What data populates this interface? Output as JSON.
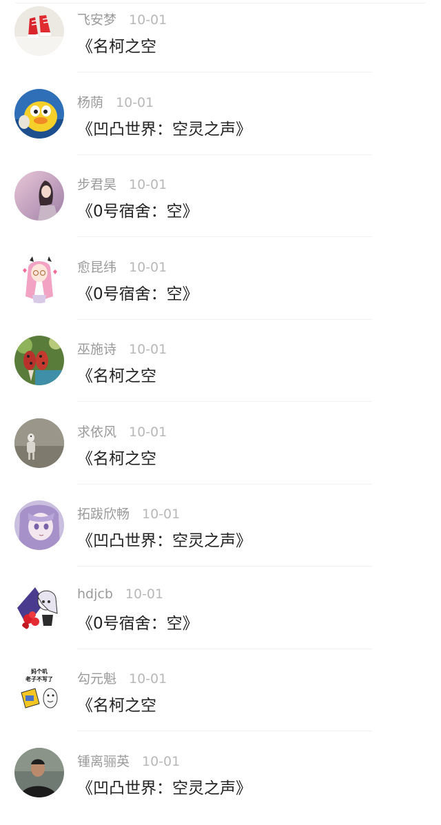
{
  "feed": {
    "items": [
      {
        "name": "飞安梦",
        "date": "10-01",
        "title": "《名柯之空",
        "avatar": "red-sneakers-avatar-icon"
      },
      {
        "name": "杨荫",
        "date": "10-01",
        "title": "《凹凸世界：空灵之声》",
        "avatar": "yellow-duck-avatar-icon"
      },
      {
        "name": "步君昊",
        "date": "10-01",
        "title": "《0号宿舍：空》",
        "avatar": "girl-portrait-avatar-icon"
      },
      {
        "name": "愈昆纬",
        "date": "10-01",
        "title": "《0号宿舍：空》",
        "avatar": "pink-hair-anime-avatar-icon"
      },
      {
        "name": "巫施诗",
        "date": "10-01",
        "title": "《名柯之空",
        "avatar": "ladybug-shoes-avatar-icon"
      },
      {
        "name": "求依风",
        "date": "10-01",
        "title": "《名柯之空",
        "avatar": "figure-photo-avatar-icon"
      },
      {
        "name": "拓跋欣畅",
        "date": "10-01",
        "title": "《凹凸世界：空灵之声》",
        "avatar": "purple-anime-girl-avatar-icon"
      },
      {
        "name": "hdjcb",
        "date": "10-01",
        "title": "《0号宿舍：空》",
        "avatar": "roses-anime-avatar-icon"
      },
      {
        "name": "勾元魁",
        "date": "10-01",
        "title": "《名柯之空",
        "avatar": "meme-sticker-avatar-icon",
        "avatar_text": [
          "妈个叽",
          "老子不写了"
        ]
      },
      {
        "name": "锺离骊英",
        "date": "10-01",
        "title": "《凹凸世界：空灵之声》",
        "avatar": "man-photo-avatar-icon"
      }
    ]
  }
}
